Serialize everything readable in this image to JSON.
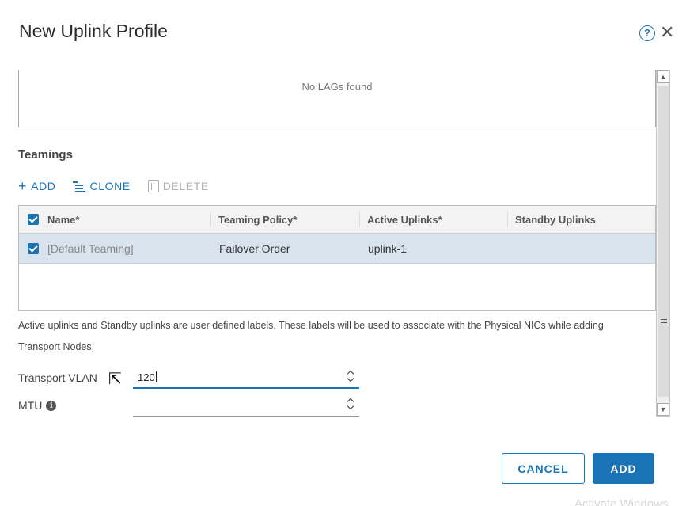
{
  "dialog": {
    "title": "New Uplink Profile",
    "help_glyph": "?",
    "close_glyph": "✕"
  },
  "lags": {
    "empty_message": "No LAGs found"
  },
  "teamings": {
    "section_title": "Teamings",
    "toolbar": {
      "add_label": "ADD",
      "clone_label": "CLONE",
      "delete_label": "DELETE"
    },
    "columns": [
      "Name",
      "Teaming Policy",
      "Active Uplinks",
      "Standby Uplinks"
    ],
    "required_marker": "*",
    "rows": [
      {
        "name": "[Default Teaming]",
        "teaming_policy": "Failover Order",
        "active_uplinks": "uplink-1",
        "standby_uplinks": "",
        "selected": true
      }
    ],
    "note_line1": "Active uplinks and Standby uplinks are user defined labels. These labels will be used to associate with the Physical NICs while adding",
    "note_line2": "Transport Nodes."
  },
  "form": {
    "transport_vlan_label": "Transport VLAN",
    "transport_vlan_value": "120",
    "mtu_label": "MTU",
    "mtu_value": ""
  },
  "footer": {
    "cancel_label": "CANCEL",
    "add_label": "ADD"
  },
  "watermark": "Activate Windows",
  "colors": {
    "accent": "#1a73b5",
    "row_selected": "#d8e3ee"
  },
  "icons": {
    "add": "plus-icon",
    "clone": "clone-icon",
    "delete": "trash-icon",
    "help": "help-icon",
    "close": "close-icon",
    "info": "info-icon"
  }
}
